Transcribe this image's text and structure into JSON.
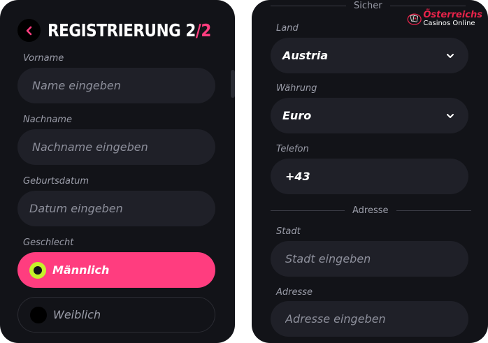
{
  "left": {
    "title_main": "REGISTRIERUNG 2",
    "title_sep": "/",
    "title_total": "2",
    "fields": [
      {
        "label": "Vorname",
        "placeholder": "Name eingeben",
        "value": ""
      },
      {
        "label": "Nachname",
        "placeholder": "Nachname eingeben",
        "value": ""
      },
      {
        "label": "Geburtsdatum",
        "placeholder": "Datum eingeben",
        "value": ""
      }
    ],
    "gender": {
      "label": "Geschlecht",
      "options": [
        {
          "label": "Männlich",
          "selected": true
        },
        {
          "label": "Weiblich",
          "selected": false
        }
      ]
    }
  },
  "right": {
    "section_top": "Sicher",
    "logo": {
      "line1": "Österreichs",
      "line2": "Casinos Online"
    },
    "land": {
      "label": "Land",
      "value": "Austria"
    },
    "currency": {
      "label": "Währung",
      "value": "Euro"
    },
    "phone": {
      "label": "Telefon",
      "value": "+43"
    },
    "section_address": "Adresse",
    "city": {
      "label": "Stadt",
      "placeholder": "Stadt eingeben"
    },
    "address": {
      "label": "Adresse",
      "placeholder": "Adresse eingeben"
    }
  },
  "colors": {
    "accent": "#ff3d7f",
    "radio_on": "#c6f22a",
    "panel_bg": "#121318",
    "field_bg": "#1f2028"
  },
  "icons": {
    "back": "chevron-left-icon",
    "dropdown": "chevron-down-icon"
  }
}
